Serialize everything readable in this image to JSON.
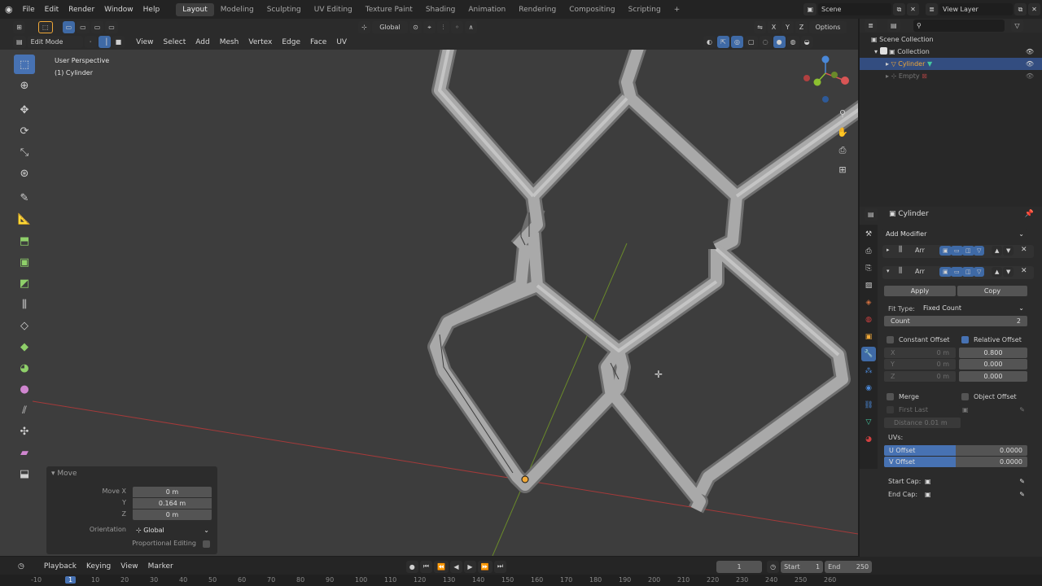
{
  "menus": [
    "File",
    "Edit",
    "Render",
    "Window",
    "Help"
  ],
  "workspaces": [
    "Layout",
    "Modeling",
    "Sculpting",
    "UV Editing",
    "Texture Paint",
    "Shading",
    "Animation",
    "Rendering",
    "Compositing",
    "Scripting"
  ],
  "active_workspace": "Layout",
  "scene_name": "Scene",
  "view_layer": "View Layer",
  "viewport_header": {
    "mode": "Edit Mode",
    "menus": [
      "View",
      "Select",
      "Add",
      "Mesh",
      "Vertex",
      "Edge",
      "Face",
      "UV"
    ],
    "orientation": "Global",
    "options": "Options",
    "axes": [
      "X",
      "Y",
      "Z"
    ]
  },
  "overlay_text": {
    "view": "User Perspective",
    "object": "(1) Cylinder"
  },
  "move_panel": {
    "title": "Move",
    "fields": [
      {
        "label": "Move X",
        "value": "0 m"
      },
      {
        "label": "Y",
        "value": "0.164 m"
      },
      {
        "label": "Z",
        "value": "0 m"
      }
    ],
    "orientation_label": "Orientation",
    "orientation_value": "Global",
    "proportional": "Proportional Editing"
  },
  "timeline": {
    "menus": [
      "Playback",
      "Keying",
      "View",
      "Marker"
    ],
    "current_frame": "1",
    "start_label": "Start",
    "start": "1",
    "end_label": "End",
    "end": "250"
  },
  "ruler_ticks": [
    "-10",
    "1",
    "10",
    "20",
    "30",
    "40",
    "50",
    "60",
    "70",
    "80",
    "90",
    "100",
    "110",
    "120",
    "130",
    "140",
    "150",
    "160",
    "170",
    "180",
    "190",
    "200",
    "210",
    "220",
    "230",
    "240",
    "250",
    "260"
  ],
  "outliner": {
    "items": [
      "Scene Collection",
      "Collection",
      "Cylinder",
      "Empty"
    ]
  },
  "properties": {
    "object_name": "Cylinder",
    "add_modifier": "Add Modifier",
    "modifier1": "Arr",
    "modifier2": "Arr",
    "apply": "Apply",
    "copy": "Copy",
    "fit_type_label": "Fit Type:",
    "fit_type": "Fixed Count",
    "count_label": "Count",
    "count": "2",
    "constant_offset": "Constant Offset",
    "relative_offset": "Relative Offset",
    "const": [
      {
        "label": "X",
        "value": "0 m"
      },
      {
        "label": "Y",
        "value": "0 m"
      },
      {
        "label": "Z",
        "value": "0 m"
      }
    ],
    "rel": [
      "0.800",
      "0.000",
      "0.000"
    ],
    "merge": "Merge",
    "object_offset": "Object Offset",
    "first_last": "First Last",
    "distance": "Distance",
    "distance_value": "0.01 m",
    "uvs": "UVs:",
    "u_offset": "U Offset",
    "u_value": "0.0000",
    "v_offset": "V Offset",
    "v_value": "0.0000",
    "start_cap": "Start Cap:",
    "end_cap": "End Cap:"
  },
  "colors": {
    "accent": "#4772b3",
    "active_item": "#f0a838",
    "red_axis": "#a43a3a",
    "green_axis": "#6a8a2a"
  }
}
